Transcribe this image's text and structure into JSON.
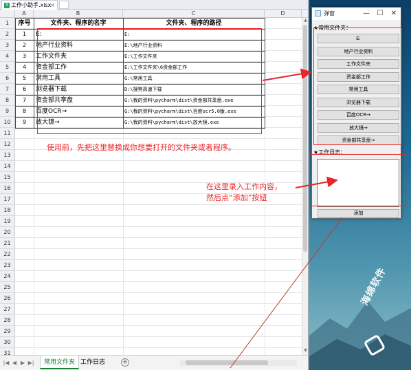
{
  "spreadsheet": {
    "file_tab": "工作小助手.xlsx",
    "columns": [
      "A",
      "B",
      "C",
      "D"
    ],
    "row_numbers": [
      "1",
      "2",
      "3",
      "4",
      "5",
      "6",
      "7",
      "8",
      "9",
      "10",
      "11",
      "12",
      "13",
      "14",
      "15",
      "16",
      "17",
      "18",
      "19",
      "20",
      "21",
      "22",
      "23",
      "24",
      "25",
      "26",
      "27",
      "28",
      "29",
      "30",
      "31"
    ],
    "headers": {
      "seq": "序号",
      "name": "文件夹、程序的名字",
      "path": "文件夹、程序的路径"
    },
    "rows": [
      {
        "seq": "1",
        "name": "E:",
        "path": "E:"
      },
      {
        "seq": "2",
        "name": "地产行业资料",
        "path": "E:\\地产行业资料"
      },
      {
        "seq": "3",
        "name": "工作文件夹",
        "path": "E:\\工作文件夹"
      },
      {
        "seq": "4",
        "name": "资金部工作",
        "path": "E:\\工作文件夹\\6资金部工作"
      },
      {
        "seq": "5",
        "name": "常用工具",
        "path": "G:\\常用工具"
      },
      {
        "seq": "6",
        "name": "浏览器下载",
        "path": "D:\\搜狗高速下载"
      },
      {
        "seq": "7",
        "name": "资金部共享盘",
        "path": "G:\\我的资料\\pycharm\\dist\\资金部共享盘.exe"
      },
      {
        "seq": "8",
        "name": "百度OCR→",
        "path": "G:\\我的资料\\pycharm\\dist\\百度ocr5.0版.exe"
      },
      {
        "seq": "9",
        "name": "放大镜→",
        "path": "G:\\我的资料\\pycharm\\dist\\放大镜.exe"
      }
    ],
    "note": "使用前，先把这里替换成你想要打开的文件夹或者程序。",
    "sheet_tabs": [
      "常用文件夹",
      "工作日志"
    ],
    "active_sheet": "常用文件夹"
  },
  "app": {
    "title": "弹窗",
    "group_common": "★常用文件夹：",
    "buttons": [
      "E:",
      "地产行业资料",
      "工作文件夹",
      "资金部工作",
      "常用工具",
      "浏览器下载",
      "百度OCR→",
      "放大镜→",
      "资金部共享盘→"
    ],
    "group_log": "★工作日志：",
    "log_value": "",
    "add_label": "添加"
  },
  "annotation_log": "在这里录入工作内容，\n然后点“添加”按钮",
  "watermark": "海绵软件",
  "colors": {
    "annotation": "#e8262a",
    "sheet_active": "#1a7f37"
  }
}
